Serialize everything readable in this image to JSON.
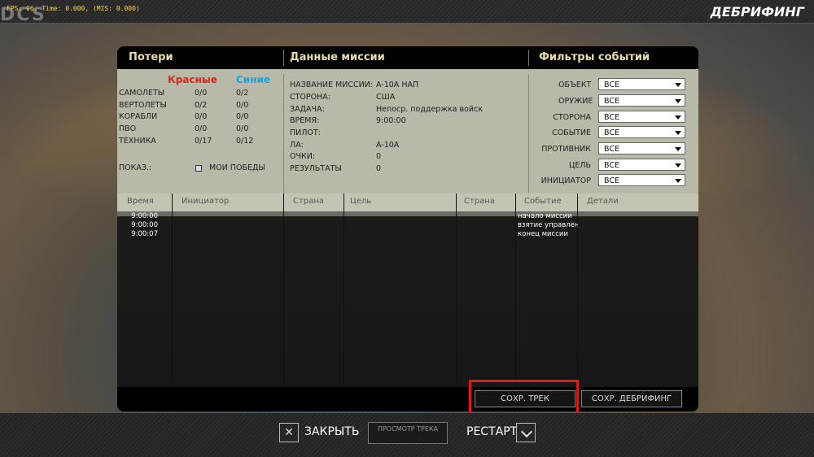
{
  "overlay": {
    "logo": "DCS",
    "fps_text": "FPS: 96, Time: 0.000, (MIS: 0.000)"
  },
  "screen_title": "ДЕБРИФИНГ",
  "sections": {
    "losses": "Потери",
    "mission_data": "Данные миссии",
    "event_filters": "Фильтры событий"
  },
  "losses": {
    "red_header": "Красные",
    "blue_header": "Синие",
    "rows": [
      {
        "label": "САМОЛЕТЫ",
        "red": "0/0",
        "blue": "0/2"
      },
      {
        "label": "ВЕРТОЛЕТЫ",
        "red": "0/2",
        "blue": "0/0"
      },
      {
        "label": "КОРАБЛИ",
        "red": "0/0",
        "blue": "0/0"
      },
      {
        "label": "ПВО",
        "red": "0/0",
        "blue": "0/0"
      },
      {
        "label": "ТЕХНИКА",
        "red": "0/17",
        "blue": "0/12"
      }
    ],
    "show_label": "ПОКАЗ.:",
    "my_wins_label": "МОИ ПОБЕДЫ"
  },
  "mission": {
    "rows": [
      {
        "label": "НАЗВАНИЕ МИССИИ:",
        "value": "A-10A НАП"
      },
      {
        "label": "СТОРОНА:",
        "value": "США"
      },
      {
        "label": "ЗАДАЧА:",
        "value": "Непоср. поддержка войск"
      },
      {
        "label": "ВРЕМЯ:",
        "value": "9:00:00"
      },
      {
        "label": "ПИЛОТ:",
        "value": ""
      },
      {
        "label": "ЛА:",
        "value": "A-10A"
      },
      {
        "label": "ОЧКИ:",
        "value": "0"
      },
      {
        "label": "РЕЗУЛЬТАТЫ",
        "value": "0"
      }
    ]
  },
  "filters": [
    {
      "label": "ОБЪЕКТ",
      "value": "ВСЕ"
    },
    {
      "label": "ОРУЖИЕ",
      "value": "ВСЕ"
    },
    {
      "label": "СТОРОНА",
      "value": "ВСЕ"
    },
    {
      "label": "СОБЫТИЕ",
      "value": "ВСЕ"
    },
    {
      "label": "ПРОТИВНИК",
      "value": "ВСЕ"
    },
    {
      "label": "ЦЕЛЬ",
      "value": "ВСЕ"
    },
    {
      "label": "ИНИЦИАТОР",
      "value": "ВСЕ"
    }
  ],
  "events_table": {
    "columns": [
      "Время",
      "Инициатор",
      "Страна",
      "Цель",
      "Страна",
      "Событие",
      "Детали"
    ],
    "rows": [
      {
        "time": "9:00:00",
        "event": "начало миссии"
      },
      {
        "time": "9:00:00",
        "event": "взятие управления"
      },
      {
        "time": "9:00:07",
        "event": "конец миссии"
      }
    ]
  },
  "buttons": {
    "save_track": "СОХР. ТРЕК",
    "save_debriefing": "СОХР. ДЕБРИФИНГ",
    "close": "ЗАКРЫТЬ",
    "close_glyph": "✕",
    "view_track": "ПРОСМОТР ТРЕКА",
    "restart": "РЕСТАРТ"
  },
  "colors": {
    "red_team": "#e0241c",
    "blue_team": "#1ea2de",
    "section_header": "#e8dca8",
    "highlight": "#e01818"
  }
}
